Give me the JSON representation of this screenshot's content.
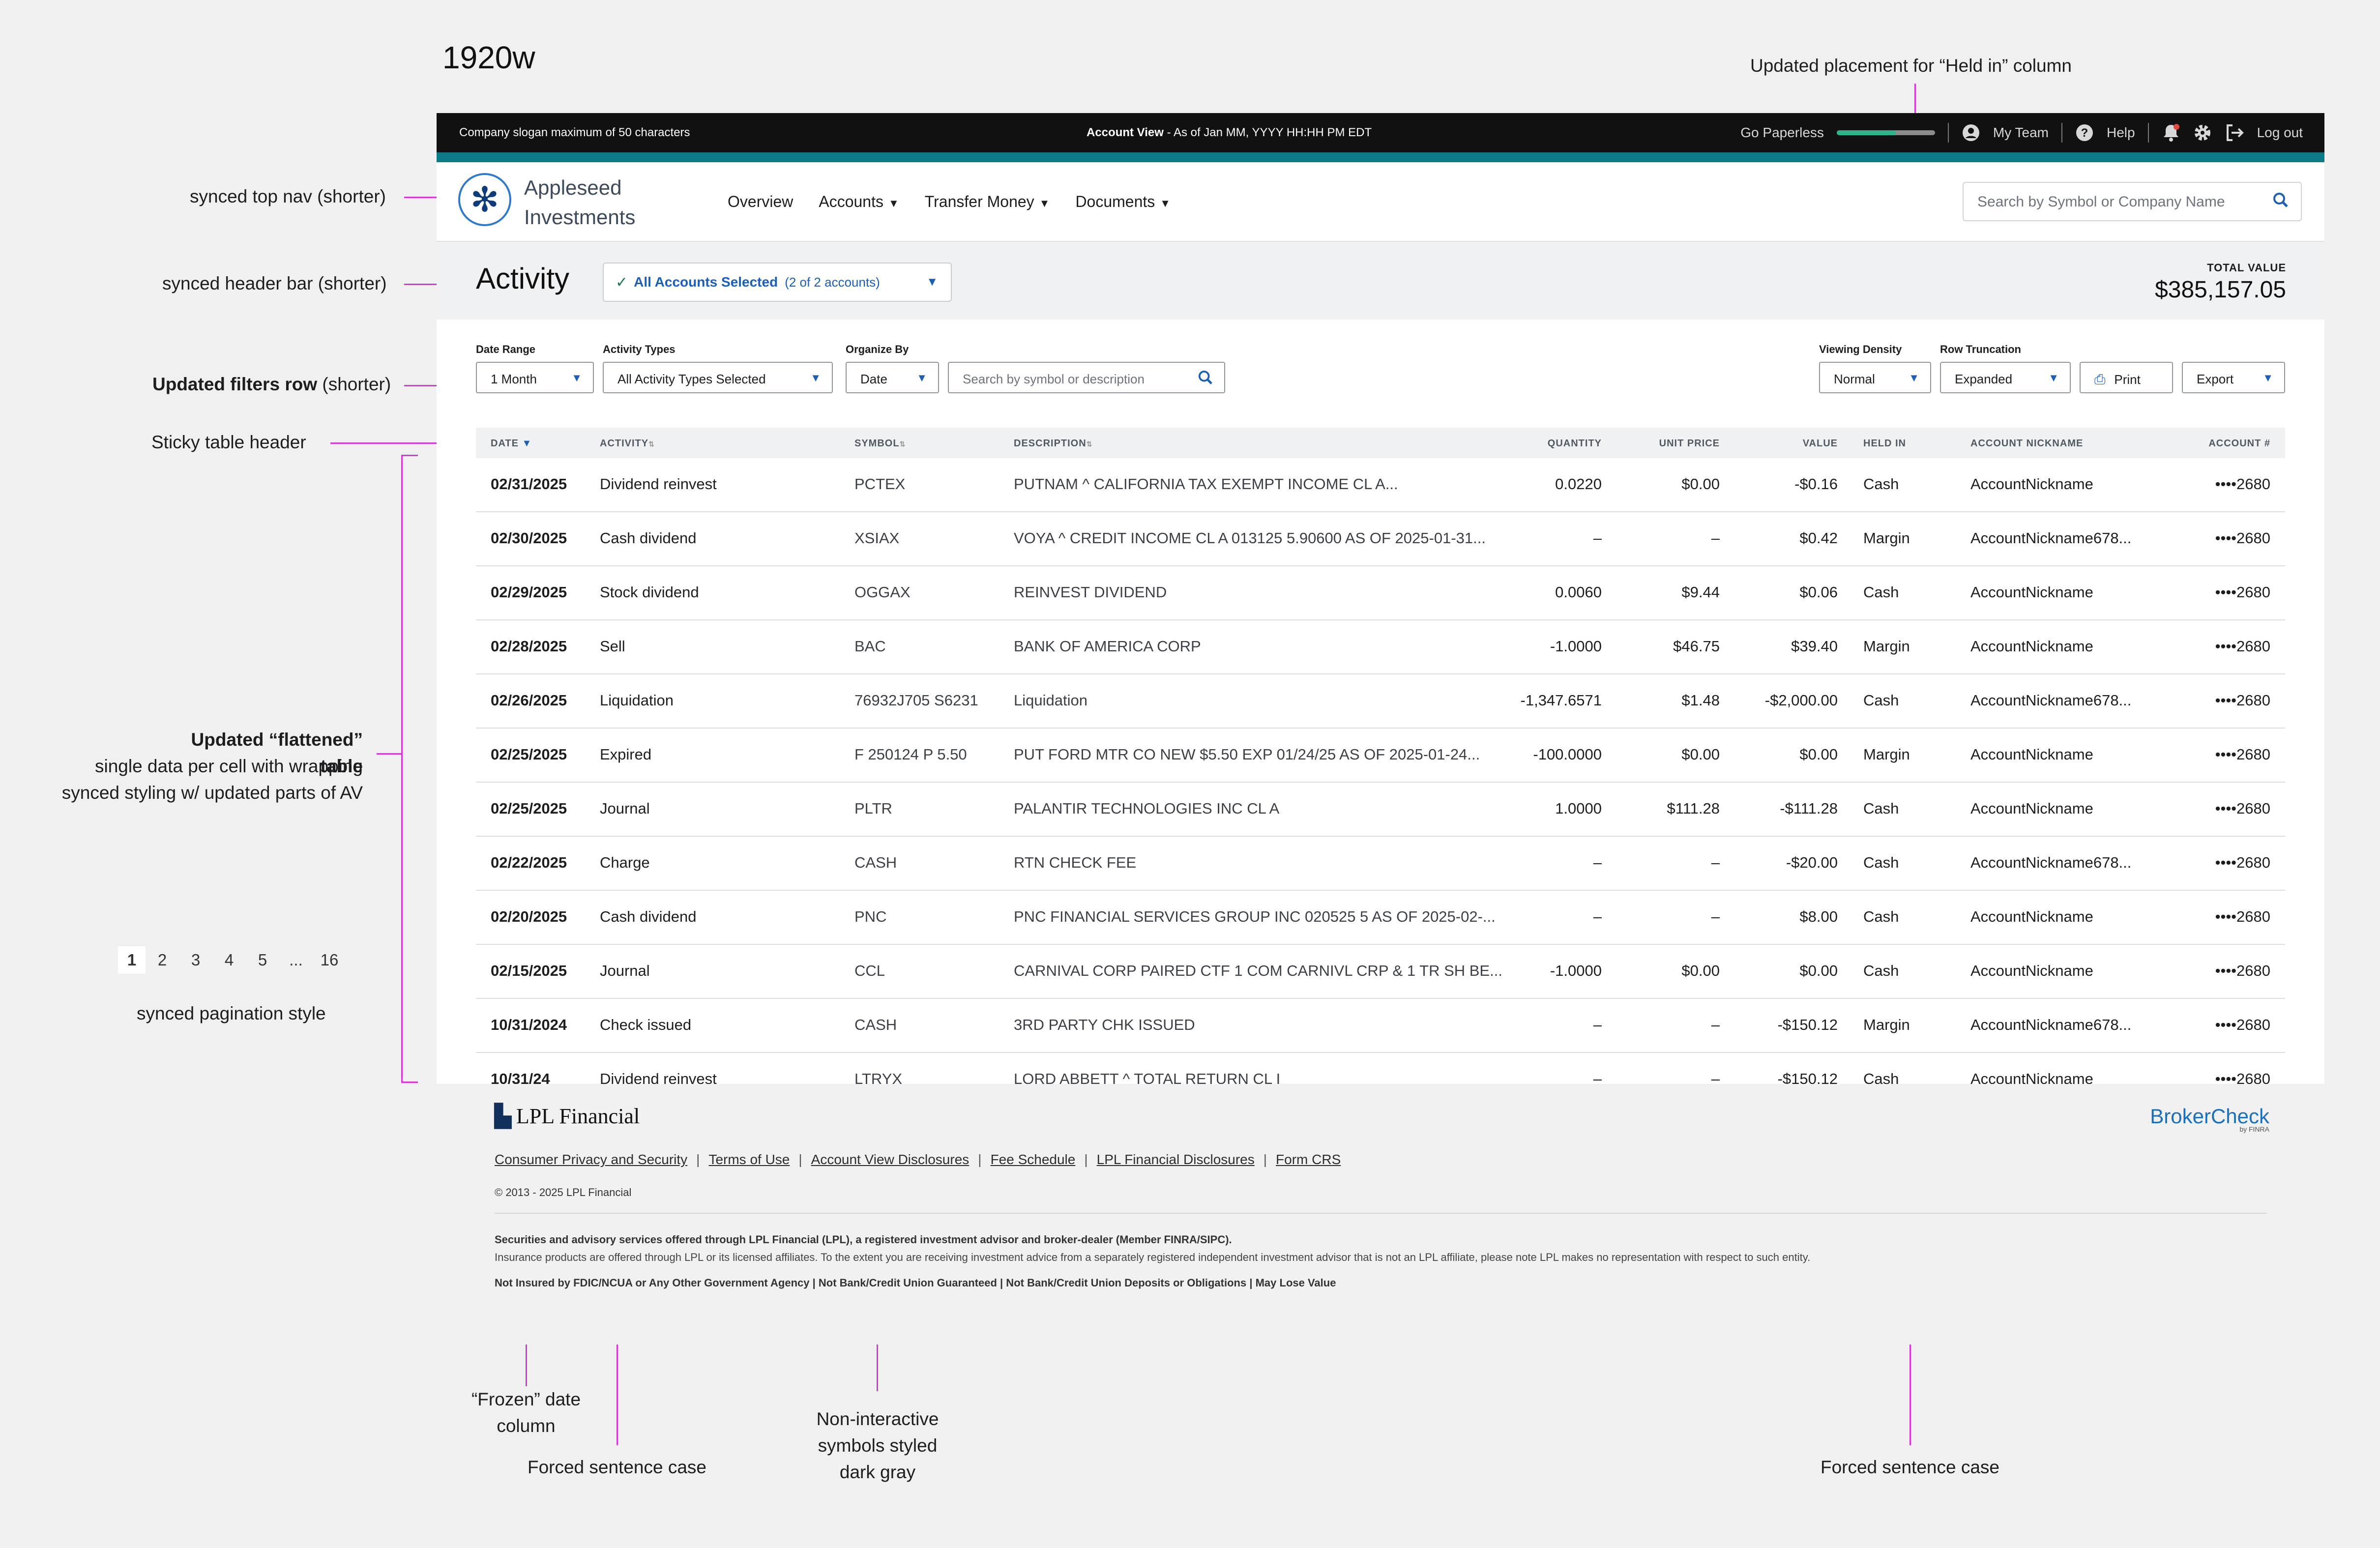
{
  "annotations": {
    "width_label": "1920w",
    "top_nav": "synced top nav (shorter)",
    "header_bar": "synced header bar (shorter)",
    "filters_row_bold": "Updated filters row",
    "filters_row_rest": " (shorter)",
    "sticky_header": "Sticky table header",
    "flattened_bold": "Updated “flattened” table",
    "flattened_line2": "single data per cell with wrapping",
    "flattened_line3": "synced styling w/ updated parts of AV",
    "pagination_note": "synced pagination style",
    "held_in_note": "Updated placement for “Held in” column",
    "frozen_line1": "“Frozen” date",
    "frozen_line2": "column",
    "forced_sentence_case_1": "Forced sentence case",
    "symbols_line1": "Non-interactive",
    "symbols_line2": "symbols styled",
    "symbols_line3": "dark gray",
    "forced_sentence_case_2": "Forced sentence case"
  },
  "pagination": [
    "1",
    "2",
    "3",
    "4",
    "5",
    "...",
    "16"
  ],
  "topbar": {
    "slogan": "Company slogan maximum of 50 characters",
    "account_view_bold": "Account View",
    "account_view_rest": " - As of Jan MM, YYYY HH:HH PM EDT",
    "paperless": "Go Paperless",
    "my_team": "My Team",
    "help": "Help",
    "logout": "Log out"
  },
  "brand": {
    "line1": "Appleseed",
    "line2": "Investments"
  },
  "nav": [
    "Overview",
    "Accounts",
    "Transfer Money",
    "Documents"
  ],
  "search_top": {
    "placeholder": "Search by Symbol or Company Name"
  },
  "header": {
    "title": "Activity",
    "accounts_selected": "All Accounts Selected",
    "accounts_count": "(2 of 2 accounts)",
    "total_value_label": "TOTAL VALUE",
    "total_value": "$385,157.05"
  },
  "filters": {
    "date_range_label": "Date Range",
    "date_range_value": "1 Month",
    "activity_types_label": "Activity Types",
    "activity_types_value": "All Activity Types Selected",
    "organize_by_label": "Organize By",
    "organize_by_value": "Date",
    "search_placeholder": "Search by symbol or description",
    "viewing_density_label": "Viewing Density",
    "viewing_density_value": "Normal",
    "row_truncation_label": "Row Truncation",
    "row_truncation_value": "Expanded",
    "print": "Print",
    "export": "Export"
  },
  "table": {
    "headers": [
      "DATE",
      "ACTIVITY",
      "SYMBOL",
      "DESCRIPTION",
      "QUANTITY",
      "UNIT PRICE",
      "VALUE",
      "HELD IN",
      "ACCOUNT NICKNAME",
      "ACCOUNT #"
    ],
    "rows": [
      {
        "date": "02/31/2025",
        "activity": "Dividend reinvest",
        "symbol": "PCTEX",
        "description": "PUTNAM ^ CALIFORNIA TAX EXEMPT INCOME CL A...",
        "quantity": "0.0220",
        "unit_price": "$0.00",
        "value": "-$0.16",
        "held_in": "Cash",
        "nickname": "AccountNickname",
        "account": "••••2680"
      },
      {
        "date": "02/30/2025",
        "activity": "Cash dividend",
        "symbol": "XSIAX",
        "description": "VOYA ^ CREDIT INCOME CL A 013125 5.90600 AS OF 2025-01-31...",
        "quantity": "–",
        "unit_price": "–",
        "value": "$0.42",
        "held_in": "Margin",
        "nickname": "AccountNickname678...",
        "account": "••••2680"
      },
      {
        "date": "02/29/2025",
        "activity": "Stock dividend",
        "symbol": "OGGAX",
        "description": "REINVEST DIVIDEND",
        "quantity": "0.0060",
        "unit_price": "$9.44",
        "value": "$0.06",
        "held_in": "Cash",
        "nickname": "AccountNickname",
        "account": "••••2680"
      },
      {
        "date": "02/28/2025",
        "activity": "Sell",
        "symbol": "BAC",
        "description": "BANK OF AMERICA CORP",
        "quantity": "-1.0000",
        "unit_price": "$46.75",
        "value": "$39.40",
        "held_in": "Margin",
        "nickname": "AccountNickname",
        "account": "••••2680"
      },
      {
        "date": "02/26/2025",
        "activity": "Liquidation",
        "symbol": "76932J705 S6231",
        "description": "Liquidation",
        "quantity": "-1,347.6571",
        "unit_price": "$1.48",
        "value": "-$2,000.00",
        "held_in": "Cash",
        "nickname": "AccountNickname678...",
        "account": "••••2680"
      },
      {
        "date": "02/25/2025",
        "activity": "Expired",
        "symbol": "F 250124 P 5.50",
        "description": "PUT FORD MTR CO NEW $5.50 EXP 01/24/25 AS OF 2025-01-24...",
        "quantity": "-100.0000",
        "unit_price": "$0.00",
        "value": "$0.00",
        "held_in": "Margin",
        "nickname": "AccountNickname",
        "account": "••••2680"
      },
      {
        "date": "02/25/2025",
        "activity": "Journal",
        "symbol": "PLTR",
        "description": "PALANTIR TECHNOLOGIES INC CL A",
        "quantity": "1.0000",
        "unit_price": "$111.28",
        "value": "-$111.28",
        "held_in": "Cash",
        "nickname": "AccountNickname",
        "account": "••••2680"
      },
      {
        "date": "02/22/2025",
        "activity": "Charge",
        "symbol": "CASH",
        "description": "RTN CHECK FEE",
        "quantity": "–",
        "unit_price": "–",
        "value": "-$20.00",
        "held_in": "Cash",
        "nickname": "AccountNickname678...",
        "account": "••••2680"
      },
      {
        "date": "02/20/2025",
        "activity": "Cash dividend",
        "symbol": "PNC",
        "description": "PNC FINANCIAL SERVICES GROUP INC 020525 5 AS OF 2025-02-...",
        "quantity": "–",
        "unit_price": "–",
        "value": "$8.00",
        "held_in": "Cash",
        "nickname": "AccountNickname",
        "account": "••••2680"
      },
      {
        "date": "02/15/2025",
        "activity": "Journal",
        "symbol": "CCL",
        "description": "CARNIVAL CORP PAIRED CTF 1 COM CARNIVL CRP & 1 TR SH BE...",
        "quantity": "-1.0000",
        "unit_price": "$0.00",
        "value": "$0.00",
        "held_in": "Cash",
        "nickname": "AccountNickname",
        "account": "••••2680"
      },
      {
        "date": "10/31/2024",
        "activity": "Check issued",
        "symbol": "CASH",
        "description": "3RD PARTY CHK ISSUED",
        "quantity": "–",
        "unit_price": "–",
        "value": "-$150.12",
        "held_in": "Margin",
        "nickname": "AccountNickname678...",
        "account": "••••2680"
      },
      {
        "date": "10/31/24",
        "activity": "Dividend reinvest",
        "symbol": "LTRYX",
        "description": "LORD ABBETT ^ TOTAL RETURN CL I",
        "quantity": "–",
        "unit_price": "–",
        "value": "-$150.12",
        "held_in": "Cash",
        "nickname": "AccountNickname",
        "account": "••••2680"
      }
    ]
  },
  "footer": {
    "brand": "LPL Financial",
    "brokercheck": "BrokerCheck",
    "brokercheck_sub": "by FINRA",
    "links": [
      "Consumer Privacy and Security",
      "Terms of Use",
      "Account View Disclosures",
      "Fee Schedule",
      "LPL Financial Disclosures",
      "Form CRS"
    ],
    "copyright": "© 2013 - 2025 LPL Financial",
    "disclosure_bold": "Securities and advisory services offered through LPL Financial (LPL), a registered investment advisor and broker-dealer (Member FINRA/SIPC).",
    "disclosure_text": "Insurance products are offered through LPL or its licensed affiliates.  To the extent you are receiving investment advice from a separately registered independent investment advisor that is not an LPL affiliate, please note LPL makes no representation with respect to such entity.",
    "not_insured": "Not Insured by FDIC/NCUA or Any Other Government Agency | Not Bank/Credit Union Guaranteed | Not Bank/Credit Union Deposits or Obligations | May Lose Value"
  },
  "colors": {
    "accent": "#1c5fb8",
    "teal": "#0b7a86",
    "annotation": "#d63ad6",
    "topbar": "#111111"
  },
  "icons": [
    "user-icon",
    "help-icon",
    "bell-icon",
    "gear-icon",
    "logout-icon",
    "search-icon",
    "check-icon",
    "chevron-down-icon",
    "printer-icon",
    "sort-icon"
  ]
}
